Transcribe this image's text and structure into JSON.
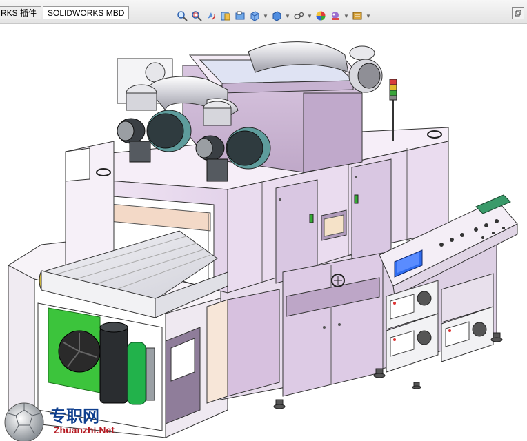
{
  "tabs": [
    {
      "label": "RKS 插件"
    },
    {
      "label": "SOLIDWORKS MBD"
    }
  ],
  "toolbar": {
    "icons": [
      "zoom-to-fit-icon",
      "zoom-area-icon",
      "previous-view-icon",
      "section-view-icon",
      "dynamic-annotation-icon",
      "view-orientation-icon",
      "display-style-icon",
      "hide-show-items-icon",
      "edit-appearance-icon",
      "apply-scene-icon",
      "view-settings-icon"
    ]
  },
  "model": {
    "description_colors": {
      "body": "#ecdff0",
      "panel": "#cdb9d6",
      "frame": "#f4f4f4",
      "green": "#3cc43c",
      "screen": "#2f6cf0",
      "conveyor": "#e8e8ee"
    }
  },
  "watermark": {
    "title": "专职网",
    "url": "Zhuanzhi.Net"
  }
}
